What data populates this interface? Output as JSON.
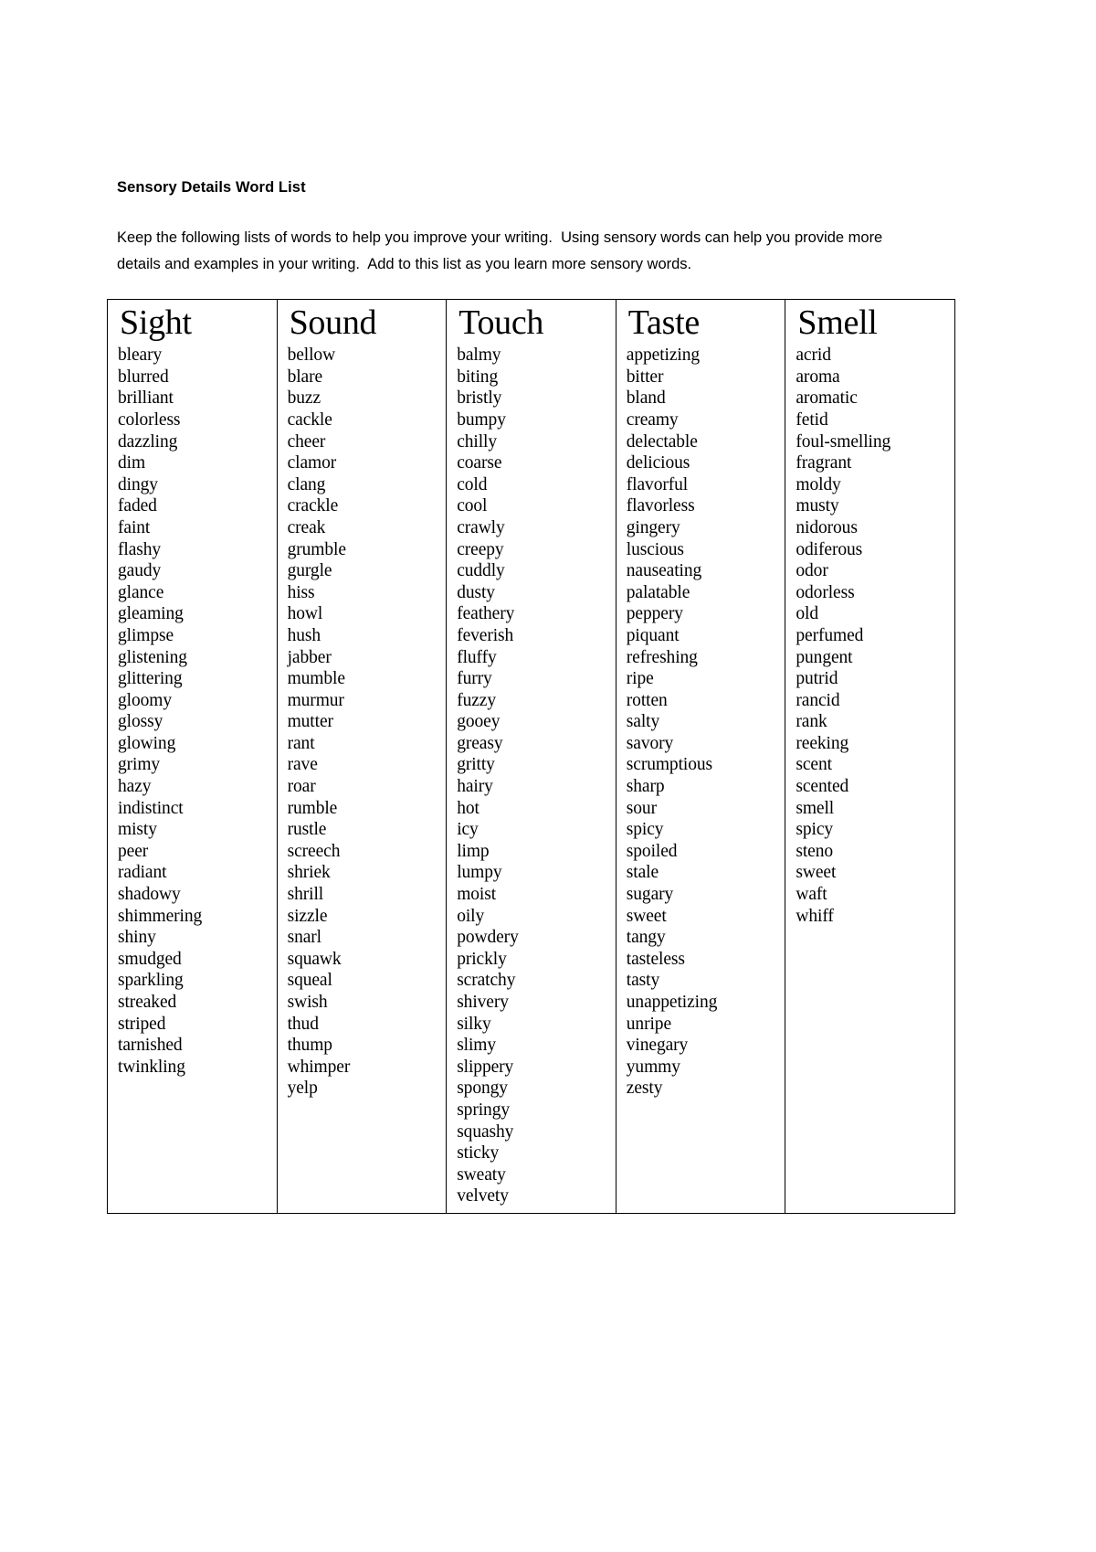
{
  "document": {
    "title": "Sensory Details Word List",
    "intro": "Keep the following lists of words to help you improve your writing.  Using sensory words can help you provide more details and examples in your writing.  Add to this list as you learn more sensory words."
  },
  "table": {
    "columns": [
      {
        "header": "Sight",
        "words": [
          "bleary",
          "blurred",
          "brilliant",
          "colorless",
          "dazzling",
          "dim",
          "dingy",
          "faded",
          "faint",
          "flashy",
          "gaudy",
          "glance",
          "gleaming",
          "glimpse",
          "glistening",
          "glittering",
          "gloomy",
          "glossy",
          "glowing",
          "grimy",
          "hazy",
          "indistinct",
          "misty",
          "peer",
          "radiant",
          "shadowy",
          "shimmering",
          "shiny",
          "smudged",
          "sparkling",
          "streaked",
          "striped",
          "tarnished",
          "twinkling"
        ]
      },
      {
        "header": "Sound",
        "words": [
          "bellow",
          "blare",
          "buzz",
          "cackle",
          "cheer",
          "clamor",
          "clang",
          "crackle",
          "creak",
          "grumble",
          "gurgle",
          "hiss",
          "howl",
          "hush",
          "jabber",
          "mumble",
          "murmur",
          "mutter",
          "rant",
          "rave",
          "roar",
          "rumble",
          "rustle",
          "screech",
          "shriek",
          "shrill",
          "sizzle",
          "snarl",
          "squawk",
          "squeal",
          "swish",
          "thud",
          "thump",
          "whimper",
          "yelp"
        ]
      },
      {
        "header": "Touch",
        "words": [
          "balmy",
          "biting",
          "bristly",
          "bumpy",
          "chilly",
          "coarse",
          "cold",
          "cool",
          "crawly",
          "creepy",
          "cuddly",
          "dusty",
          "feathery",
          "feverish",
          "fluffy",
          "furry",
          "fuzzy",
          "gooey",
          "greasy",
          "gritty",
          "hairy",
          "hot",
          "icy",
          "limp",
          "lumpy",
          "moist",
          "oily",
          "powdery",
          "prickly",
          "scratchy",
          "shivery",
          "silky",
          "slimy",
          "slippery",
          "spongy",
          "springy",
          "squashy",
          "sticky",
          "sweaty",
          "velvety"
        ]
      },
      {
        "header": "Taste",
        "words": [
          "appetizing",
          "bitter",
          "bland",
          "creamy",
          "delectable",
          "delicious",
          "flavorful",
          "flavorless",
          "gingery",
          "luscious",
          "nauseating",
          "palatable",
          "peppery",
          "piquant",
          "refreshing",
          "ripe",
          "rotten",
          "salty",
          "savory",
          "scrumptious",
          "sharp",
          "sour",
          "spicy",
          "spoiled",
          "stale",
          "sugary",
          "sweet",
          "tangy",
          "tasteless",
          "tasty",
          "unappetizing",
          "unripe",
          "vinegary",
          "yummy",
          "zesty"
        ]
      },
      {
        "header": "Smell",
        "words": [
          "acrid",
          "aroma",
          "aromatic",
          "fetid",
          "foul-smelling",
          "fragrant",
          "moldy",
          "musty",
          "nidorous",
          "odiferous",
          "odor",
          "odorless",
          "old",
          "perfumed",
          "pungent",
          "putrid",
          "rancid",
          "rank",
          "reeking",
          "scent",
          "scented",
          "smell",
          "spicy",
          "steno",
          "sweet",
          "waft",
          "whiff"
        ]
      }
    ]
  }
}
